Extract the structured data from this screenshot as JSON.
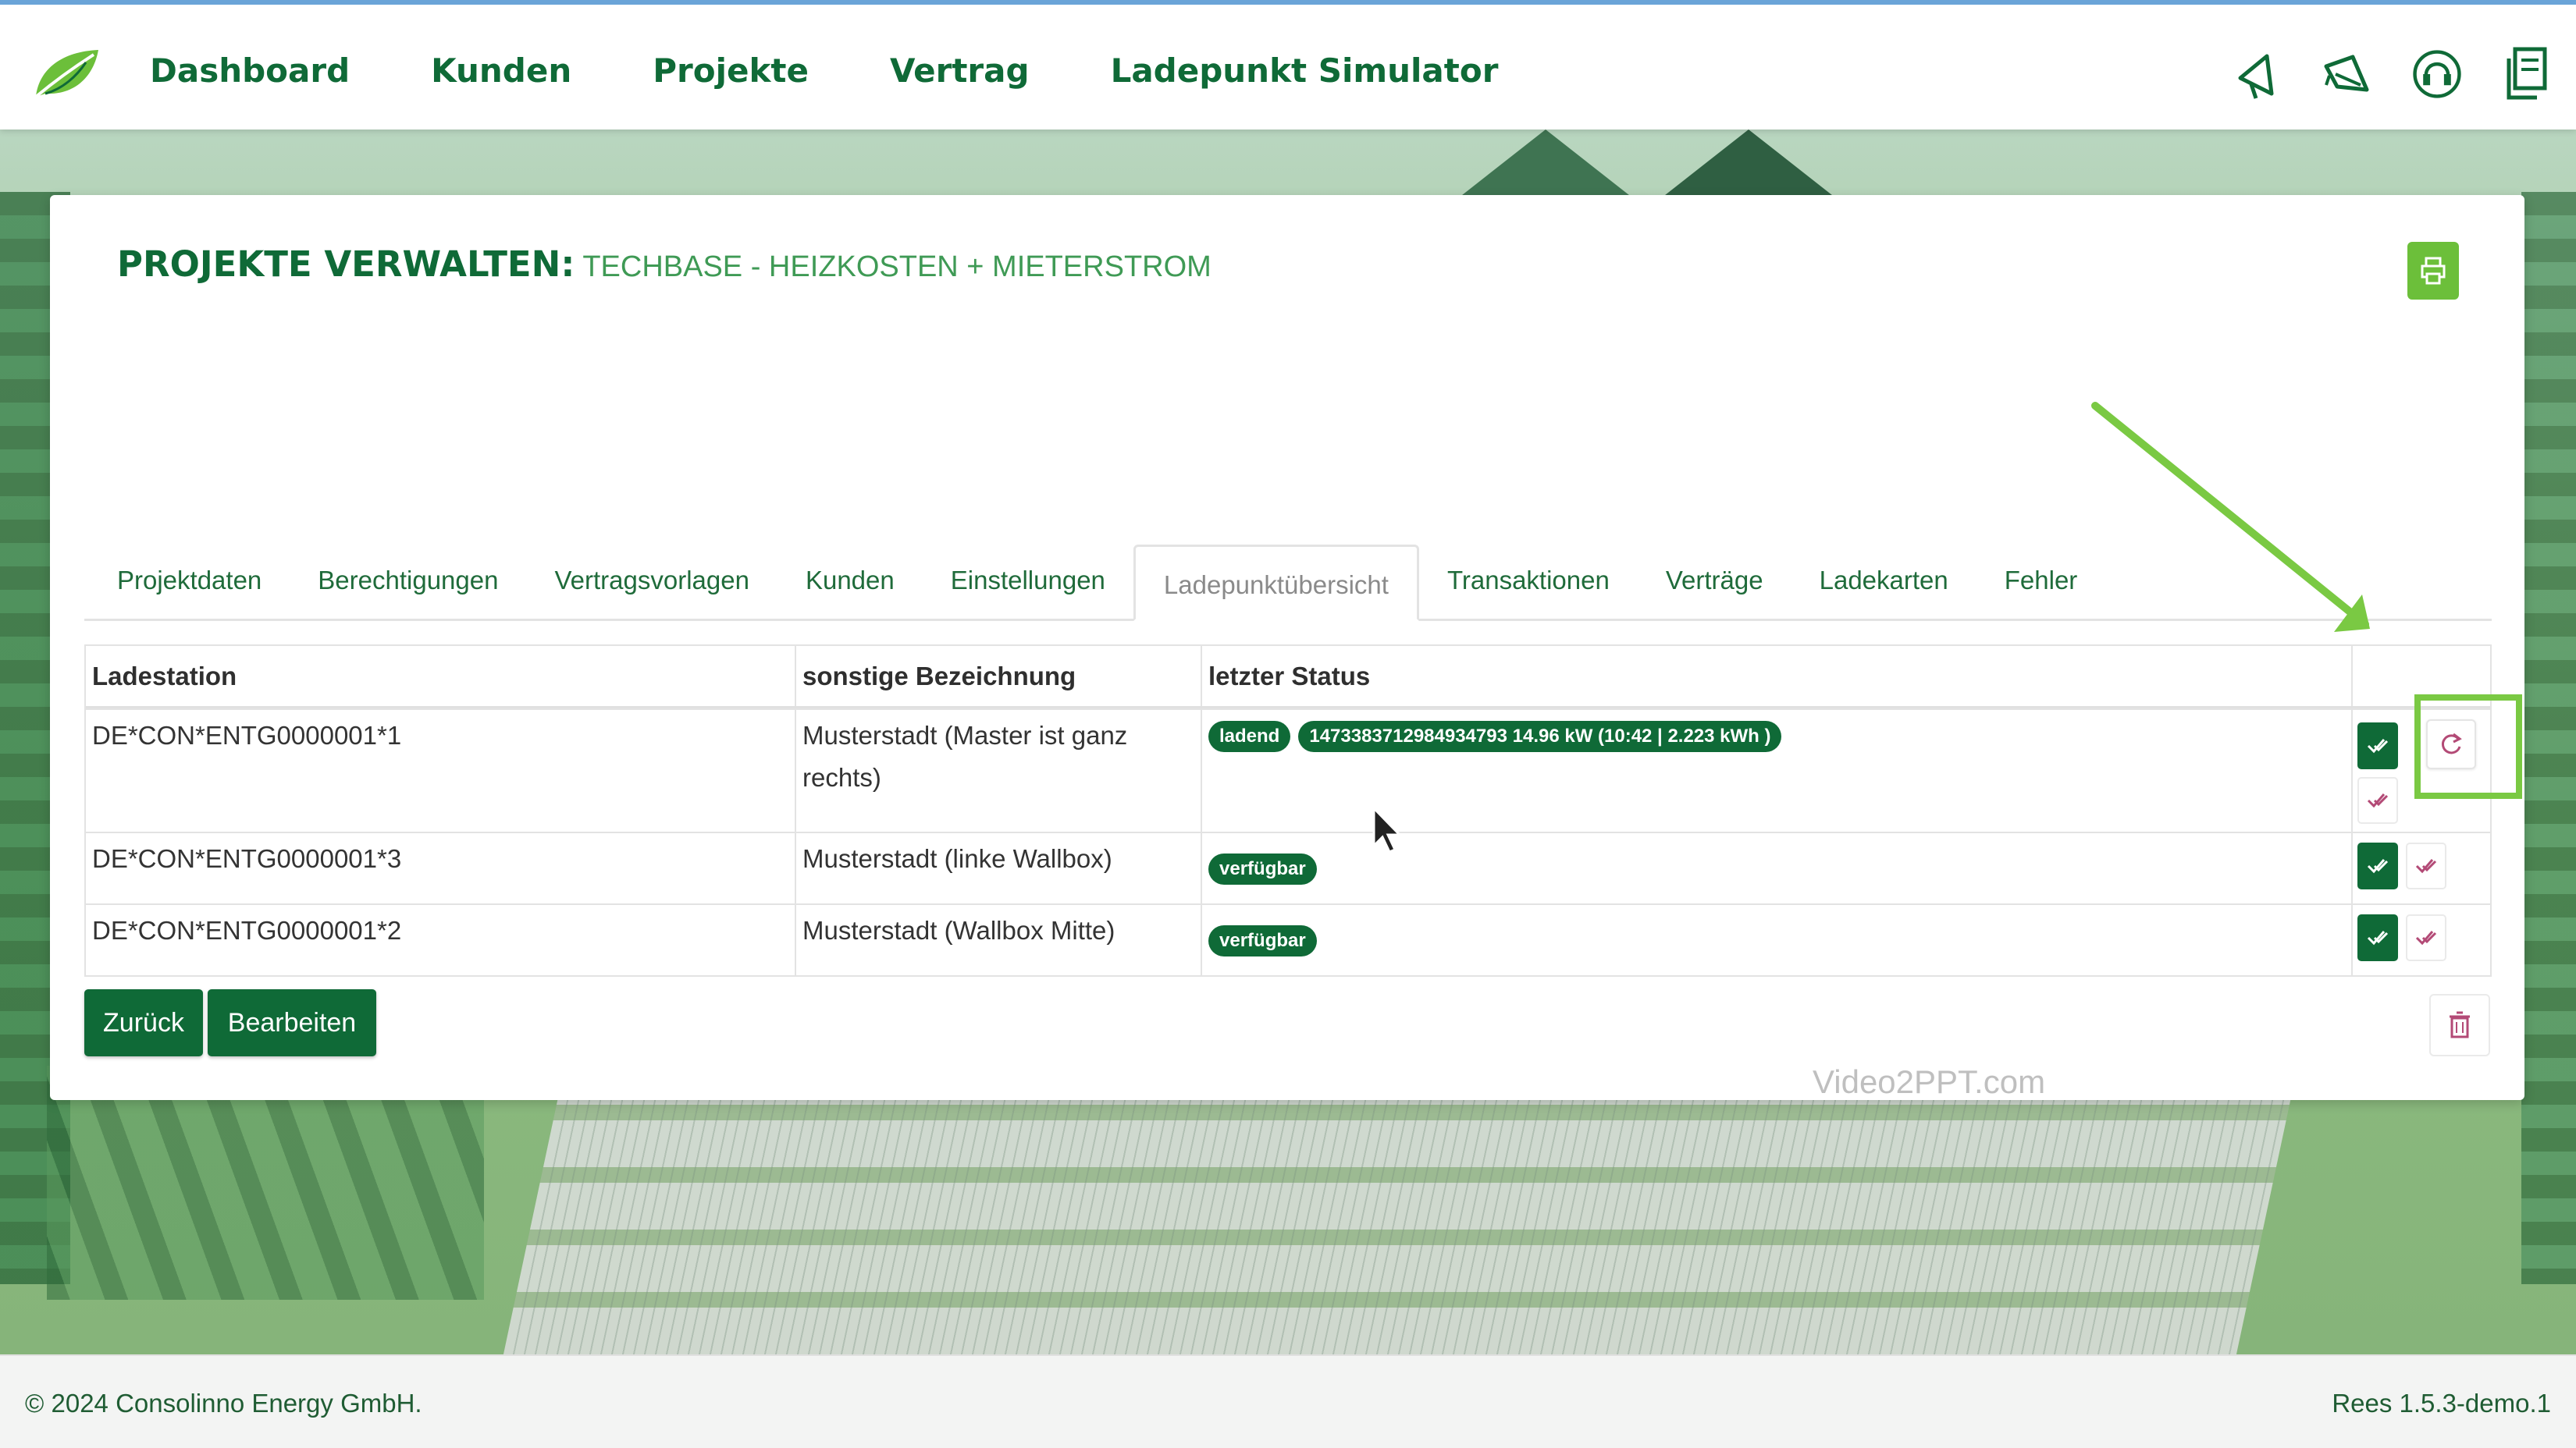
{
  "nav": {
    "items": [
      "Dashboard",
      "Kunden",
      "Projekte",
      "Vertrag",
      "Ladepunkt Simulator"
    ],
    "icons": [
      "megaphone-icon",
      "bullhorn-icon",
      "support-headset-icon",
      "documents-icon"
    ]
  },
  "card": {
    "title": "PROJEKTE VERWALTEN:",
    "subtitle": "TECHBASE - HEIZKOSTEN + MIETERSTROM"
  },
  "tabs": [
    {
      "label": "Projektdaten"
    },
    {
      "label": "Berechtigungen"
    },
    {
      "label": "Vertragsvorlagen"
    },
    {
      "label": "Kunden"
    },
    {
      "label": "Einstellungen"
    },
    {
      "label": "Ladepunktübersicht",
      "active": true
    },
    {
      "label": "Transaktionen"
    },
    {
      "label": "Verträge"
    },
    {
      "label": "Ladekarten"
    },
    {
      "label": "Fehler"
    }
  ],
  "table": {
    "headers": [
      "Ladestation",
      "sonstige Bezeichnung",
      "letzter Status"
    ],
    "rows": [
      {
        "station": "DE*CON*ENTG0000001*1",
        "label": "Musterstadt (Master ist ganz rechts)",
        "status": "ladend",
        "detail": "1473383712984934793 14.96 kW (10:42 | 2.223 kWh )"
      },
      {
        "station": "DE*CON*ENTG0000001*3",
        "label": "Musterstadt (linke Wallbox)",
        "status": "verfügbar"
      },
      {
        "station": "DE*CON*ENTG0000001*2",
        "label": "Musterstadt (Wallbox Mitte)",
        "status": "verfügbar"
      }
    ]
  },
  "buttons": {
    "back": "Zurück",
    "edit": "Bearbeiten"
  },
  "watermark": "Video2PPT.com",
  "footer": {
    "copyright": "© 2024 Consolinno Energy GmbH.",
    "version": "Rees 1.5.3-demo.1"
  },
  "colors": {
    "primary": "#0f6a37",
    "accent": "#6cbf3a",
    "highlight": "#7ac943"
  }
}
